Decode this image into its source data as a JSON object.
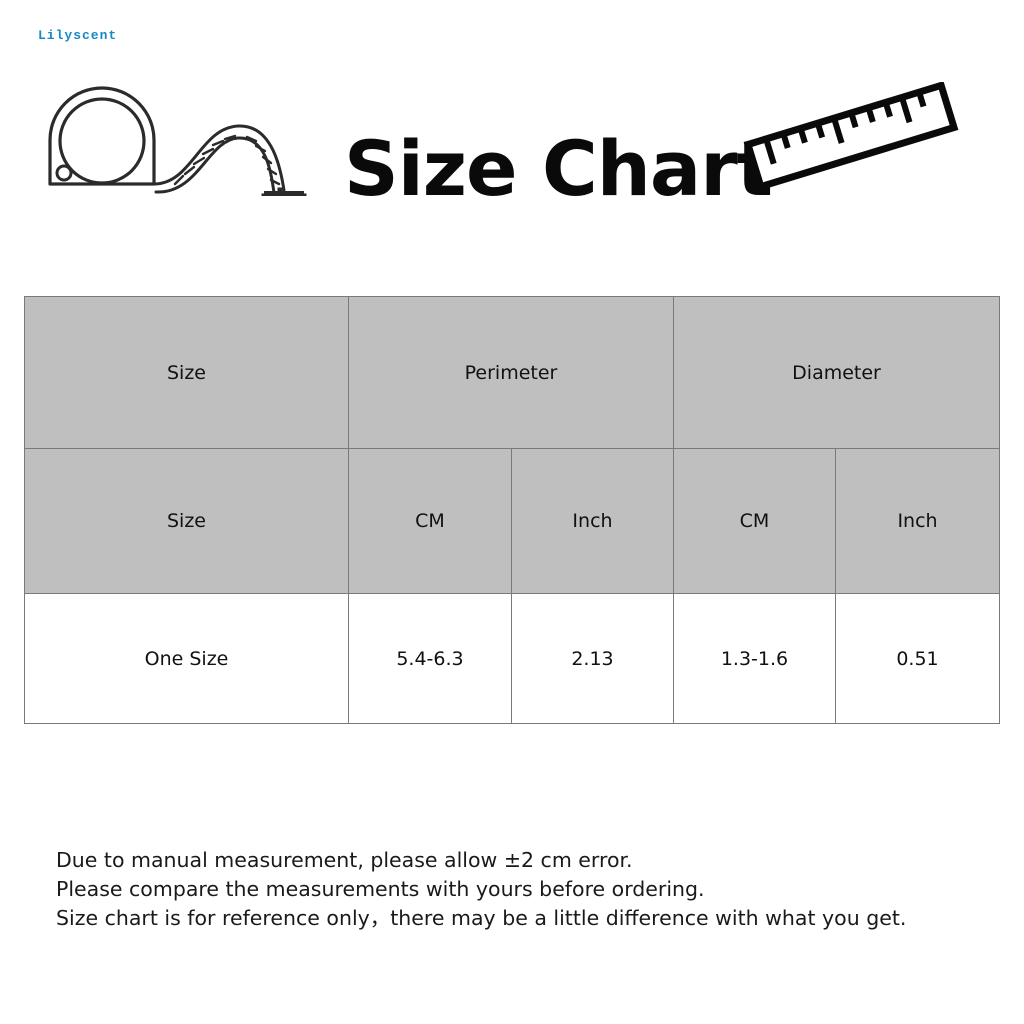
{
  "watermark": {
    "text": "Lilyscent",
    "color": "#1788c4"
  },
  "header": {
    "title": "Size Chart",
    "tape_measure_icon": "tape-measure-icon",
    "ruler_icon": "ruler-icon"
  },
  "table": {
    "group_header": {
      "size": "Size",
      "perimeter": "Perimeter",
      "diameter": "Diameter"
    },
    "sub_header": {
      "size": "Size",
      "perimeter_cm": "CM",
      "perimeter_inch": "Inch",
      "diameter_cm": "CM",
      "diameter_inch": "Inch"
    },
    "rows": [
      {
        "size": "One Size",
        "perimeter_cm": "5.4-6.3",
        "perimeter_inch": "2.13",
        "diameter_cm": "1.3-1.6",
        "diameter_inch": "0.51"
      }
    ],
    "header_fill": "#bfbfbf",
    "border_color": "#7a7a7a"
  },
  "notes": {
    "line1": "Due to manual measurement, please allow ±2 cm error.",
    "line2": "Please compare the measurements with yours before ordering.",
    "line3": "Size chart is for reference only，there may be a little difference with what you get."
  }
}
